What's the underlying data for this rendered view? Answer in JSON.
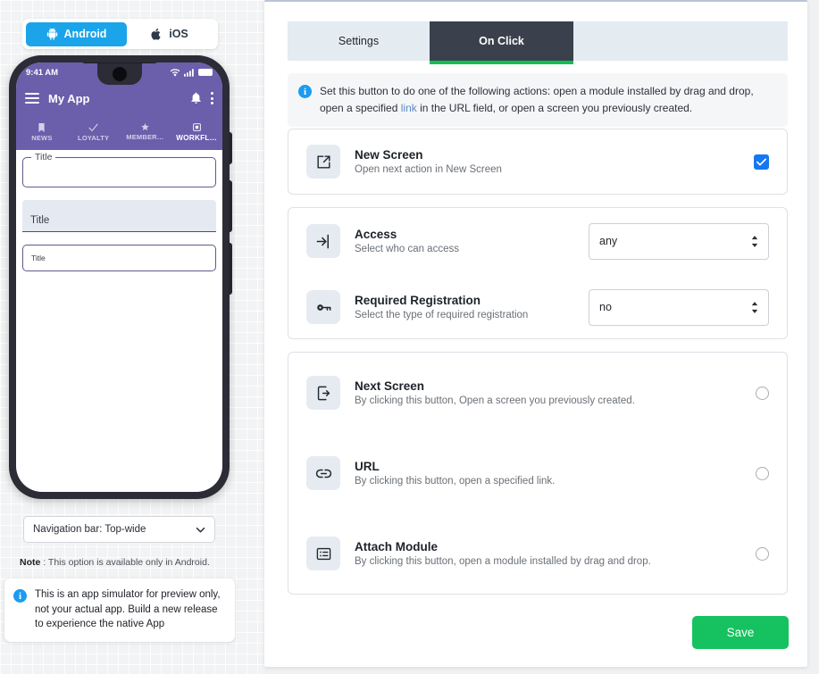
{
  "platform_toggle": {
    "android_label": "Android",
    "ios_label": "iOS",
    "selected": "Android"
  },
  "phone_preview": {
    "status_time": "9:41 AM",
    "app_title": "My App",
    "tabs": [
      {
        "label": "NEWS",
        "icon": "bookmark-icon",
        "glyph": "⚑",
        "active": false
      },
      {
        "label": "LOYALTY",
        "icon": "check-icon",
        "glyph": "✓",
        "active": false
      },
      {
        "label": "MEMBER…",
        "icon": "star-icon",
        "glyph": "★",
        "active": false
      },
      {
        "label": "WORKFL…",
        "icon": "module-icon",
        "glyph": "▣",
        "active": true
      }
    ],
    "fields": [
      {
        "style": "outlined",
        "label": "Title"
      },
      {
        "style": "filled",
        "label": "Title"
      },
      {
        "style": "plain",
        "label": "Title"
      }
    ]
  },
  "navbar_select": {
    "value": "Navigation bar: Top-wide",
    "chevron": "⌄"
  },
  "note": {
    "prefix": "Note",
    "separator": " : ",
    "text": "This option is available only in Android."
  },
  "simulator_notice": {
    "icon_char": "i",
    "text": "This is an app simulator for preview only, not your actual app. Build a new release to experience the native App"
  },
  "tabs": {
    "settings_label": "Settings",
    "onclick_label": "On Click",
    "active": "On Click",
    "active_underline_color": "#0fc14e"
  },
  "info_banner": {
    "icon_char": "i",
    "part1": "Set this button to do one of the following actions: open a module installed by drag and drop, open a specified ",
    "link_word": "link",
    "part2": " in the URL field, or open a screen you previously created."
  },
  "new_screen_card": {
    "icon": "external-link-icon",
    "title": "New Screen",
    "subtitle": "Open next action in New Screen",
    "checked": true
  },
  "access_card": {
    "rows": [
      {
        "icon": "login-arrow-icon",
        "title": "Access",
        "subtitle": "Select who can access",
        "select_value": "any"
      },
      {
        "icon": "key-icon",
        "title": "Required Registration",
        "subtitle": "Select the type of required registration",
        "select_value": "no"
      }
    ]
  },
  "options_card": {
    "rows": [
      {
        "icon": "phone-arrow-icon",
        "title": "Next Screen",
        "subtitle": "By clicking this button, Open a screen you previously created.",
        "selected": false
      },
      {
        "icon": "link-icon",
        "title": "URL",
        "subtitle": "By clicking this button, open a specified link.",
        "selected": false
      },
      {
        "icon": "list-module-icon",
        "title": "Attach Module",
        "subtitle": "By clicking this button, open a module installed by drag and drop.",
        "selected": false
      }
    ]
  },
  "save_button": {
    "label": "Save",
    "color": "#15c25f"
  }
}
